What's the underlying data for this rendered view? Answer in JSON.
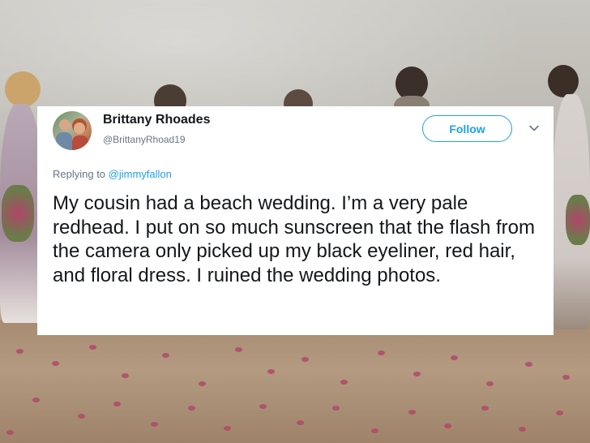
{
  "tweet": {
    "author_name": "Brittany Rhoades",
    "author_handle": "@BrittanyRhoad19",
    "follow_label": "Follow",
    "replying_prefix": "Replying to",
    "replying_mention": "@jimmyfallon",
    "text": "My cousin had a beach wedding. I’m a very pale redhead. I put on so much sunscreen that the flash from the camera only picked up my black eyeliner, red hair, and floral dress. I ruined the wedding photos."
  },
  "colors": {
    "accent": "#1da1f2",
    "secondary_text": "#657786",
    "primary_text": "#14171a",
    "card_background": "#ffffff"
  },
  "icons": {
    "caret": "chevron-down-icon",
    "avatar": "profile-photo"
  }
}
